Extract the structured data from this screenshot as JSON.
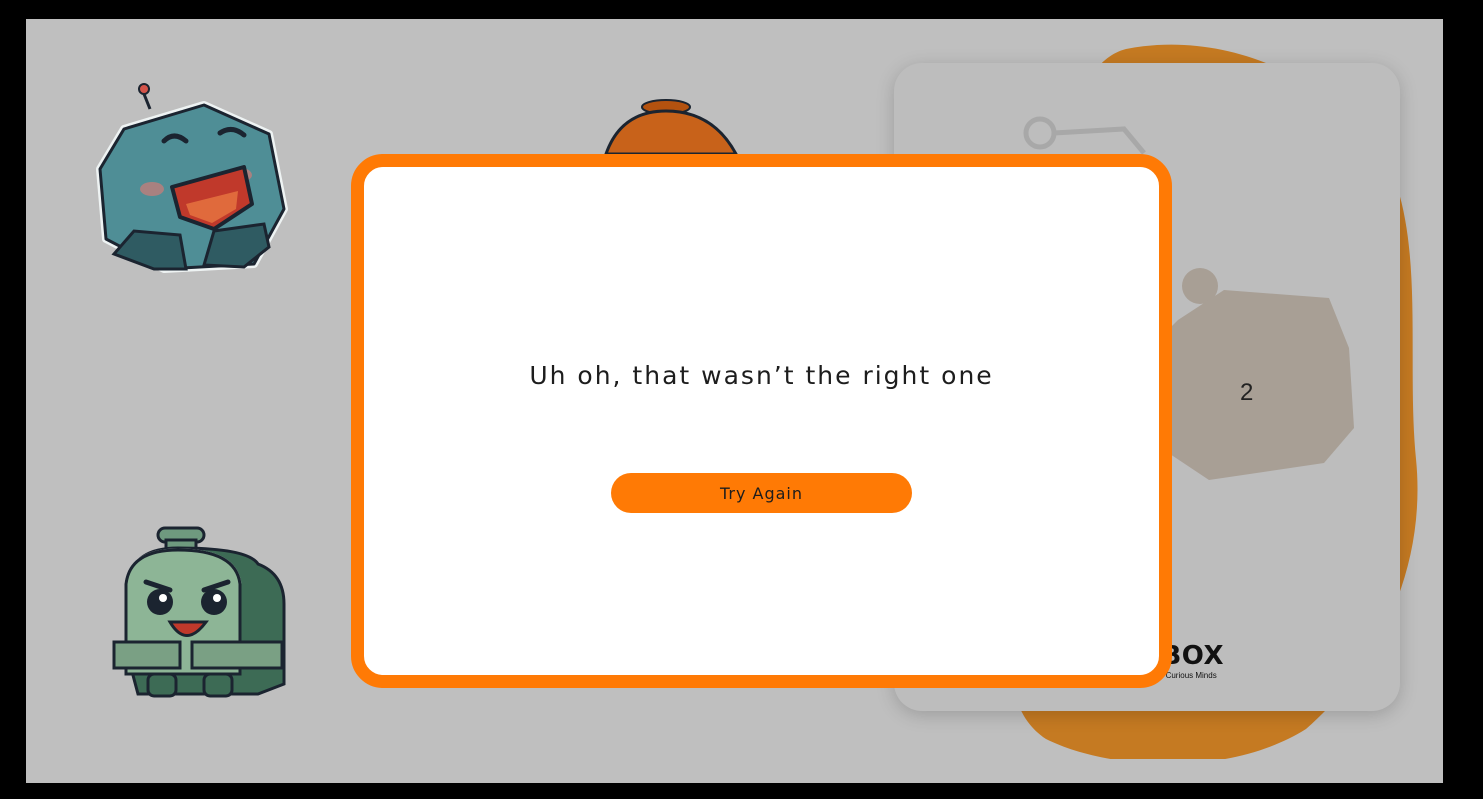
{
  "modal": {
    "message": "Uh oh, that wasn’t the right one",
    "button_label": "Try Again"
  },
  "side_card": {
    "slot_number": "2",
    "brand": {
      "name": "UGBOX",
      "tagline": "Robotics For Curious Minds"
    }
  },
  "colors": {
    "accent": "#ff7a05",
    "backdrop": "#bfbfbf",
    "page": "#000000",
    "blob": "#c57a22"
  },
  "icons": [
    "robot-sticker-laughing",
    "robot-sticker-orange",
    "robot-sticker-grinning",
    "bugbox-logo-icon"
  ]
}
